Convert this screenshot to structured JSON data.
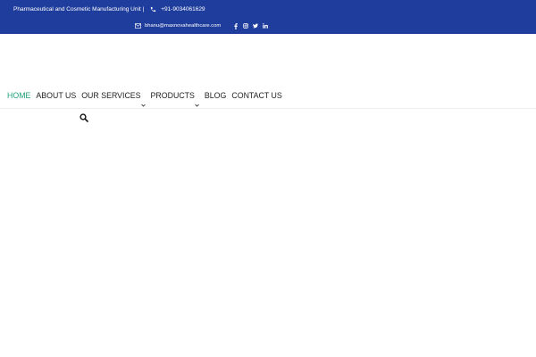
{
  "topbar": {
    "tagline": "Pharmaceutical and Cosmetic Manufacturing Unit |",
    "phone": "+91-9034061629",
    "email": "bhanu@maxnovahealthcare.com",
    "bg_color": "#1f3d9c",
    "icons": {
      "phone": "phone-icon",
      "email": "mail-icon",
      "socials": [
        "facebook-icon",
        "instagram-icon",
        "twitter-icon",
        "linkedin-icon"
      ]
    }
  },
  "nav": {
    "items": [
      {
        "label": "HOME",
        "active": true
      },
      {
        "label": "ABOUT US"
      },
      {
        "label": "OUR SERVICES",
        "dropdown": true
      },
      {
        "label": "PRODUCTS",
        "dropdown": true
      },
      {
        "label": "BLOG"
      },
      {
        "label": "CONTACT US"
      }
    ],
    "active_color": "#20a07a",
    "search_icon": "search-icon"
  }
}
